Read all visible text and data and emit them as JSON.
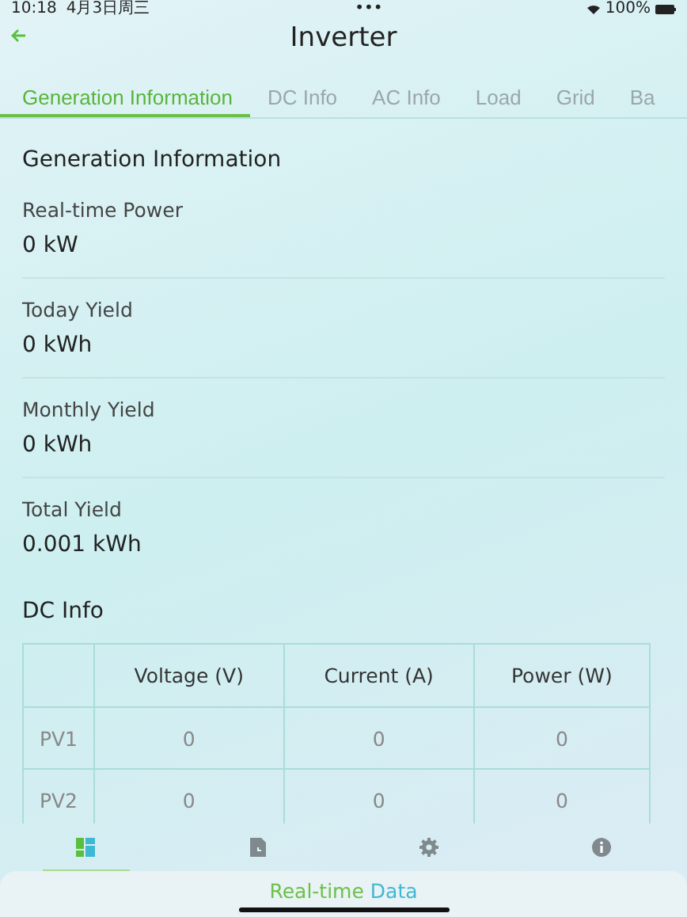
{
  "status_bar": {
    "time": "10:18",
    "date": "4月3日周三",
    "dots": "•••",
    "battery": "100%"
  },
  "nav": {
    "title": "Inverter"
  },
  "tabs": [
    {
      "label": "Generation Information",
      "selected": true
    },
    {
      "label": "DC Info",
      "selected": false
    },
    {
      "label": "AC Info",
      "selected": false
    },
    {
      "label": "Load",
      "selected": false
    },
    {
      "label": "Grid",
      "selected": false
    },
    {
      "label": "Ba",
      "selected": false
    }
  ],
  "generation": {
    "title": "Generation Information",
    "items": [
      {
        "label": "Real-time Power",
        "value": "0 kW"
      },
      {
        "label": "Today Yield",
        "value": "0 kWh"
      },
      {
        "label": "Monthly Yield",
        "value": "0 kWh"
      },
      {
        "label": "Total Yield",
        "value": "0.001 kWh"
      }
    ]
  },
  "dc_info": {
    "title": "DC Info",
    "columns": [
      "",
      "Voltage (V)",
      "Current (A)",
      "Power (W)"
    ],
    "rows": [
      [
        "PV1",
        "0",
        "0",
        "0"
      ],
      [
        "PV2",
        "0",
        "0",
        "0"
      ]
    ]
  },
  "bottom_tabs": [
    {
      "kind": "dashboard",
      "selected": true
    },
    {
      "kind": "report",
      "selected": false
    },
    {
      "kind": "settings",
      "selected": false
    },
    {
      "kind": "info",
      "selected": false
    }
  ],
  "bottom_sheet": {
    "title_part_1": "Real-time",
    "title_part_2": "Data"
  }
}
